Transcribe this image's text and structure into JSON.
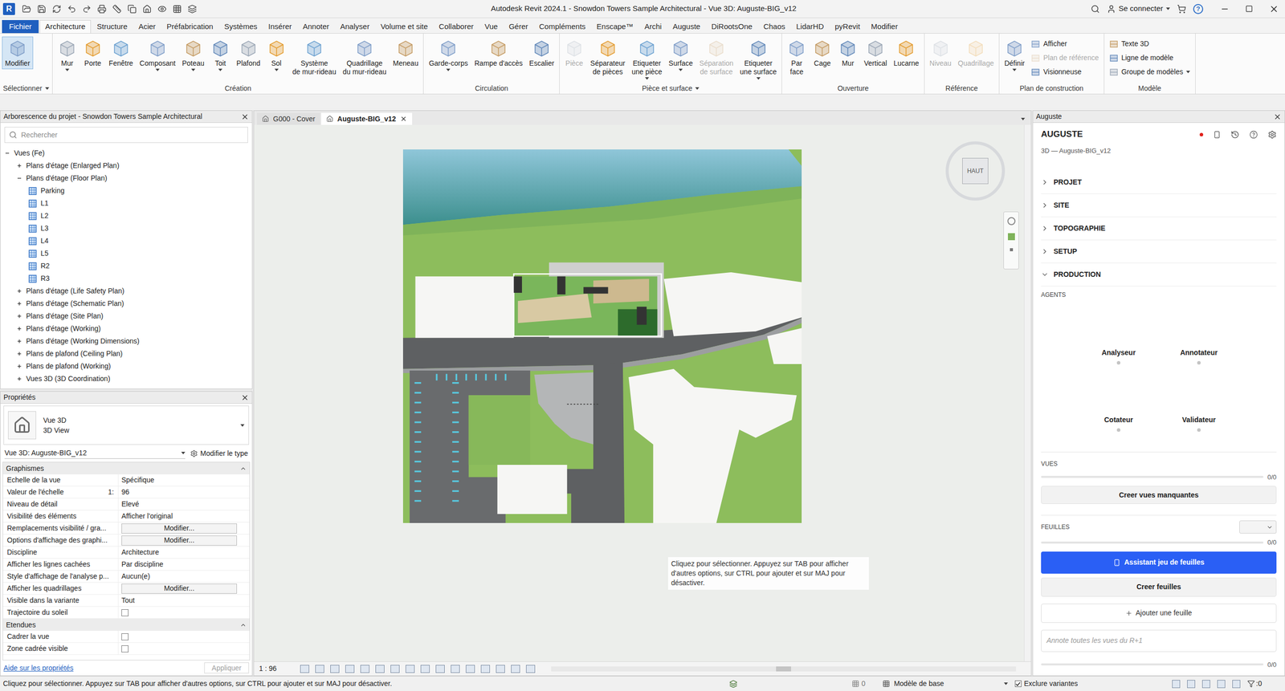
{
  "window": {
    "logo": "R",
    "title": "Autodesk Revit 2024.1 - Snowdon Towers Sample Architectural - Vue 3D: Auguste-BIG_v12",
    "sign_in": "Se connecter",
    "help": "?"
  },
  "file_tab": "Fichier",
  "ribbon_tabs": [
    {
      "label": "Architecture",
      "selected": true
    },
    {
      "label": "Structure",
      "selected": false
    },
    {
      "label": "Acier",
      "selected": false
    },
    {
      "label": "Préfabrication",
      "selected": false
    },
    {
      "label": "Systèmes",
      "selected": false
    },
    {
      "label": "Insérer",
      "selected": false
    },
    {
      "label": "Annoter",
      "selected": false
    },
    {
      "label": "Analyser",
      "selected": false
    },
    {
      "label": "Volume et site",
      "selected": false
    },
    {
      "label": "Collaborer",
      "selected": false
    },
    {
      "label": "Vue",
      "selected": false
    },
    {
      "label": "Gérer",
      "selected": false
    },
    {
      "label": "Compléments",
      "selected": false
    },
    {
      "label": "Enscape™",
      "selected": false
    },
    {
      "label": "Archi",
      "selected": false
    },
    {
      "label": "Auguste",
      "selected": false
    },
    {
      "label": "DiRootsOne",
      "selected": false
    },
    {
      "label": "Chaos",
      "selected": false
    },
    {
      "label": "LidarHD",
      "selected": false
    },
    {
      "label": "pyRevit",
      "selected": false
    },
    {
      "label": "Modifier",
      "selected": false
    }
  ],
  "ribbon_groups": [
    {
      "label": "Sélectionner",
      "dropdown": true,
      "buttons": [
        {
          "label": "Modifier",
          "kind": "large",
          "selected": true,
          "disabled": false,
          "dropdown": false
        }
      ]
    },
    {
      "label": "Création",
      "dropdown": false,
      "buttons": [
        {
          "label": "Mur",
          "kind": "large",
          "selected": false,
          "disabled": false,
          "dropdown": true
        },
        {
          "label": "Porte",
          "kind": "large",
          "selected": false,
          "disabled": false,
          "dropdown": false
        },
        {
          "label": "Fenêtre",
          "kind": "large",
          "selected": false,
          "disabled": false,
          "dropdown": false
        },
        {
          "label": "Composant",
          "kind": "large",
          "selected": false,
          "disabled": false,
          "dropdown": true
        },
        {
          "label": "Poteau",
          "kind": "large",
          "selected": false,
          "disabled": false,
          "dropdown": true
        },
        {
          "label": "Toit",
          "kind": "large",
          "selected": false,
          "disabled": false,
          "dropdown": true
        },
        {
          "label": "Plafond",
          "kind": "large",
          "selected": false,
          "disabled": false,
          "dropdown": false
        },
        {
          "label": "Sol",
          "kind": "large",
          "selected": false,
          "disabled": false,
          "dropdown": true
        },
        {
          "label": "Système\nde mur-rideau",
          "kind": "large",
          "selected": false,
          "disabled": false,
          "dropdown": false
        },
        {
          "label": "Quadrillage\ndu mur-rideau",
          "kind": "large",
          "selected": false,
          "disabled": false,
          "dropdown": false
        },
        {
          "label": "Meneau",
          "kind": "large",
          "selected": false,
          "disabled": false,
          "dropdown": false
        }
      ]
    },
    {
      "label": "Circulation",
      "dropdown": false,
      "buttons": [
        {
          "label": "Garde-corps",
          "kind": "large",
          "selected": false,
          "disabled": false,
          "dropdown": true
        },
        {
          "label": "Rampe d'accès",
          "kind": "large",
          "selected": false,
          "disabled": false,
          "dropdown": false
        },
        {
          "label": "Escalier",
          "kind": "large",
          "selected": false,
          "disabled": false,
          "dropdown": false
        }
      ]
    },
    {
      "label": "Pièce et surface",
      "dropdown": true,
      "buttons": [
        {
          "label": "Pièce",
          "kind": "large",
          "selected": false,
          "disabled": true,
          "dropdown": false
        },
        {
          "label": "Séparateur\nde pièces",
          "kind": "large",
          "selected": false,
          "disabled": false,
          "dropdown": false
        },
        {
          "label": "Etiqueter\nune pièce",
          "kind": "large",
          "selected": false,
          "disabled": false,
          "dropdown": true
        },
        {
          "label": "Surface",
          "kind": "large",
          "selected": false,
          "disabled": false,
          "dropdown": true
        },
        {
          "label": "Séparation\nde surface",
          "kind": "large",
          "selected": false,
          "disabled": true,
          "dropdown": false
        },
        {
          "label": "Etiqueter\nune surface",
          "kind": "large",
          "selected": false,
          "disabled": false,
          "dropdown": true
        }
      ]
    },
    {
      "label": "Ouverture",
      "dropdown": false,
      "buttons": [
        {
          "label": "Par\nface",
          "kind": "large",
          "selected": false,
          "disabled": false,
          "dropdown": false
        },
        {
          "label": "Cage",
          "kind": "large",
          "selected": false,
          "disabled": false,
          "dropdown": false
        },
        {
          "label": "Mur",
          "kind": "large",
          "selected": false,
          "disabled": false,
          "dropdown": false
        },
        {
          "label": "Vertical",
          "kind": "large",
          "selected": false,
          "disabled": false,
          "dropdown": false
        },
        {
          "label": "Lucarne",
          "kind": "large",
          "selected": false,
          "disabled": false,
          "dropdown": false
        }
      ]
    },
    {
      "label": "Référence",
      "dropdown": false,
      "buttons": [
        {
          "label": "Niveau",
          "kind": "large",
          "selected": false,
          "disabled": true,
          "dropdown": false
        },
        {
          "label": "Quadrillage",
          "kind": "large",
          "selected": false,
          "disabled": true,
          "dropdown": false
        }
      ]
    },
    {
      "label": "Plan de construction",
      "dropdown": false,
      "buttons": [
        {
          "label": "Définir",
          "kind": "large",
          "selected": false,
          "disabled": false,
          "dropdown": true
        },
        {
          "label": "Afficher",
          "kind": "small",
          "selected": false,
          "disabled": false,
          "dropdown": false
        },
        {
          "label": "Plan de référence",
          "kind": "small",
          "selected": false,
          "disabled": true,
          "dropdown": false
        },
        {
          "label": "Visionneuse",
          "kind": "small",
          "selected": false,
          "disabled": false,
          "dropdown": false
        }
      ]
    },
    {
      "label": "Modèle",
      "dropdown": false,
      "buttons": [
        {
          "label": "Texte 3D",
          "kind": "small",
          "selected": false,
          "disabled": false,
          "dropdown": false
        },
        {
          "label": "Ligne de modèle",
          "kind": "small",
          "selected": false,
          "disabled": false,
          "dropdown": false
        },
        {
          "label": "Groupe de modèles",
          "kind": "small",
          "selected": false,
          "disabled": false,
          "dropdown": true
        }
      ]
    }
  ],
  "browser": {
    "title": "Arborescence du projet - Snowdon Towers Sample Architectural",
    "search_placeholder": "Rechercher",
    "items": [
      {
        "label": "Vues (Fe)",
        "depth": 0,
        "kind": "folder",
        "expanded": true
      },
      {
        "label": "Plans d'étage (Enlarged Plan)",
        "depth": 1,
        "kind": "folder",
        "expanded": false
      },
      {
        "label": "Plans d'étage (Floor Plan)",
        "depth": 1,
        "kind": "folder",
        "expanded": true
      },
      {
        "label": "Parking",
        "depth": 2,
        "kind": "view",
        "expanded": false
      },
      {
        "label": "L1",
        "depth": 2,
        "kind": "view",
        "expanded": false
      },
      {
        "label": "L2",
        "depth": 2,
        "kind": "view",
        "expanded": false
      },
      {
        "label": "L3",
        "depth": 2,
        "kind": "view",
        "expanded": false
      },
      {
        "label": "L4",
        "depth": 2,
        "kind": "view",
        "expanded": false
      },
      {
        "label": "L5",
        "depth": 2,
        "kind": "view",
        "expanded": false
      },
      {
        "label": "R2",
        "depth": 2,
        "kind": "view",
        "expanded": false
      },
      {
        "label": "R3",
        "depth": 2,
        "kind": "view",
        "expanded": false
      },
      {
        "label": "Plans d'étage (Life Safety Plan)",
        "depth": 1,
        "kind": "folder",
        "expanded": false
      },
      {
        "label": "Plans d'étage (Schematic Plan)",
        "depth": 1,
        "kind": "folder",
        "expanded": false
      },
      {
        "label": "Plans d'étage (Site Plan)",
        "depth": 1,
        "kind": "folder",
        "expanded": false
      },
      {
        "label": "Plans d'étage (Working)",
        "depth": 1,
        "kind": "folder",
        "expanded": false
      },
      {
        "label": "Plans d'étage (Working Dimensions)",
        "depth": 1,
        "kind": "folder",
        "expanded": false
      },
      {
        "label": "Plans de plafond (Ceiling Plan)",
        "depth": 1,
        "kind": "folder",
        "expanded": false
      },
      {
        "label": "Plans de plafond (Working)",
        "depth": 1,
        "kind": "folder",
        "expanded": false
      },
      {
        "label": "Vues 3D (3D Coordination)",
        "depth": 1,
        "kind": "folder",
        "expanded": false
      }
    ]
  },
  "properties": {
    "title": "Propriétés",
    "type_name": "Vue 3D",
    "type_subname": "3D View",
    "instance": "Vue 3D: Auguste-BIG_v12",
    "edit_type": "Modifier le type",
    "sections": [
      {
        "label": "Graphismes",
        "rows": [
          {
            "label": "Echelle de la vue",
            "kind": "text",
            "value": "Spécifique"
          },
          {
            "label": "Valeur de l'échelle",
            "prefix": "1:",
            "kind": "text",
            "value": "96"
          },
          {
            "label": "Niveau de détail",
            "kind": "text",
            "value": "Elevé"
          },
          {
            "label": "Visibilité des éléments",
            "kind": "text",
            "value": "Afficher l'original"
          },
          {
            "label": "Remplacements visibilité / gra...",
            "kind": "button",
            "value": "Modifier..."
          },
          {
            "label": "Options d'affichage des graphi...",
            "kind": "button",
            "value": "Modifier..."
          },
          {
            "label": "Discipline",
            "kind": "text",
            "value": "Architecture"
          },
          {
            "label": "Afficher les lignes cachées",
            "kind": "text",
            "value": "Par discipline"
          },
          {
            "label": "Style d'affichage de l'analyse p...",
            "kind": "text",
            "value": "Aucun(e)"
          },
          {
            "label": "Afficher les quadrillages",
            "kind": "button",
            "value": "Modifier..."
          },
          {
            "label": "Visible dans la variante",
            "kind": "text",
            "value": "Tout"
          },
          {
            "label": "Trajectoire du soleil",
            "kind": "checkbox",
            "checked": false
          }
        ]
      },
      {
        "label": "Etendues",
        "rows": [
          {
            "label": "Cadrer la vue",
            "kind": "checkbox",
            "checked": false
          },
          {
            "label": "Zone cadrée visible",
            "kind": "checkbox",
            "checked": false
          }
        ]
      }
    ],
    "help_link": "Aide sur les propriétés",
    "apply": {
      "label": "Appliquer",
      "disabled": true
    }
  },
  "view": {
    "tabs": [
      {
        "label": "G000 - Cover",
        "selected": false,
        "closable": false
      },
      {
        "label": "Auguste-BIG_v12",
        "selected": true,
        "closable": true
      }
    ],
    "viewcube": "HAUT",
    "tooltip": "Cliquez pour sélectionner. Appuyez sur TAB pour afficher d'autres options, sur CTRL pour ajouter et sur MAJ pour désactiver.",
    "scale": "1 : 96"
  },
  "auguste": {
    "panel_title": "Auguste",
    "heading": "AUGUSTE",
    "status_color": "#e0201b",
    "subtitle": "3D — Auguste-BIG_v12",
    "sections": [
      {
        "label": "PROJET",
        "expanded": false
      },
      {
        "label": "SITE",
        "expanded": false
      },
      {
        "label": "TOPOGRAPHIE",
        "expanded": false
      },
      {
        "label": "SETUP",
        "expanded": false
      },
      {
        "label": "PRODUCTION",
        "expanded": true
      }
    ],
    "agents_label": "AGENTS",
    "agents": [
      {
        "label": "Analyseur",
        "active": false
      },
      {
        "label": "Annotateur",
        "active": false
      },
      {
        "label": "Cotateur",
        "active": false
      },
      {
        "label": "Validateur",
        "active": false
      }
    ],
    "vues": {
      "label": "VUES",
      "level": 0,
      "count": "0/0",
      "button": "Creer vues manquantes"
    },
    "feuilles": {
      "label": "FEUILLES",
      "select_value": "",
      "level": 0,
      "count": "0/0",
      "primary": "Assistant jeu de feuilles",
      "create": "Creer feuilles",
      "add": "Ajouter une feuille"
    },
    "prompt": {
      "placeholder": "Annote toutes les vues du R+1",
      "level": 0,
      "count": "0/0"
    }
  },
  "status_bar": {
    "message": "Cliquez pour sélectionner. Appuyez sur TAB pour afficher d'autres options, sur CTRL pour ajouter et sur MAJ pour désactiver.",
    "workset_count": "0",
    "design_option": "Modèle de base",
    "exclude_options": {
      "label": "Exclure variantes",
      "checked": true
    },
    "filter_count": ":0"
  }
}
